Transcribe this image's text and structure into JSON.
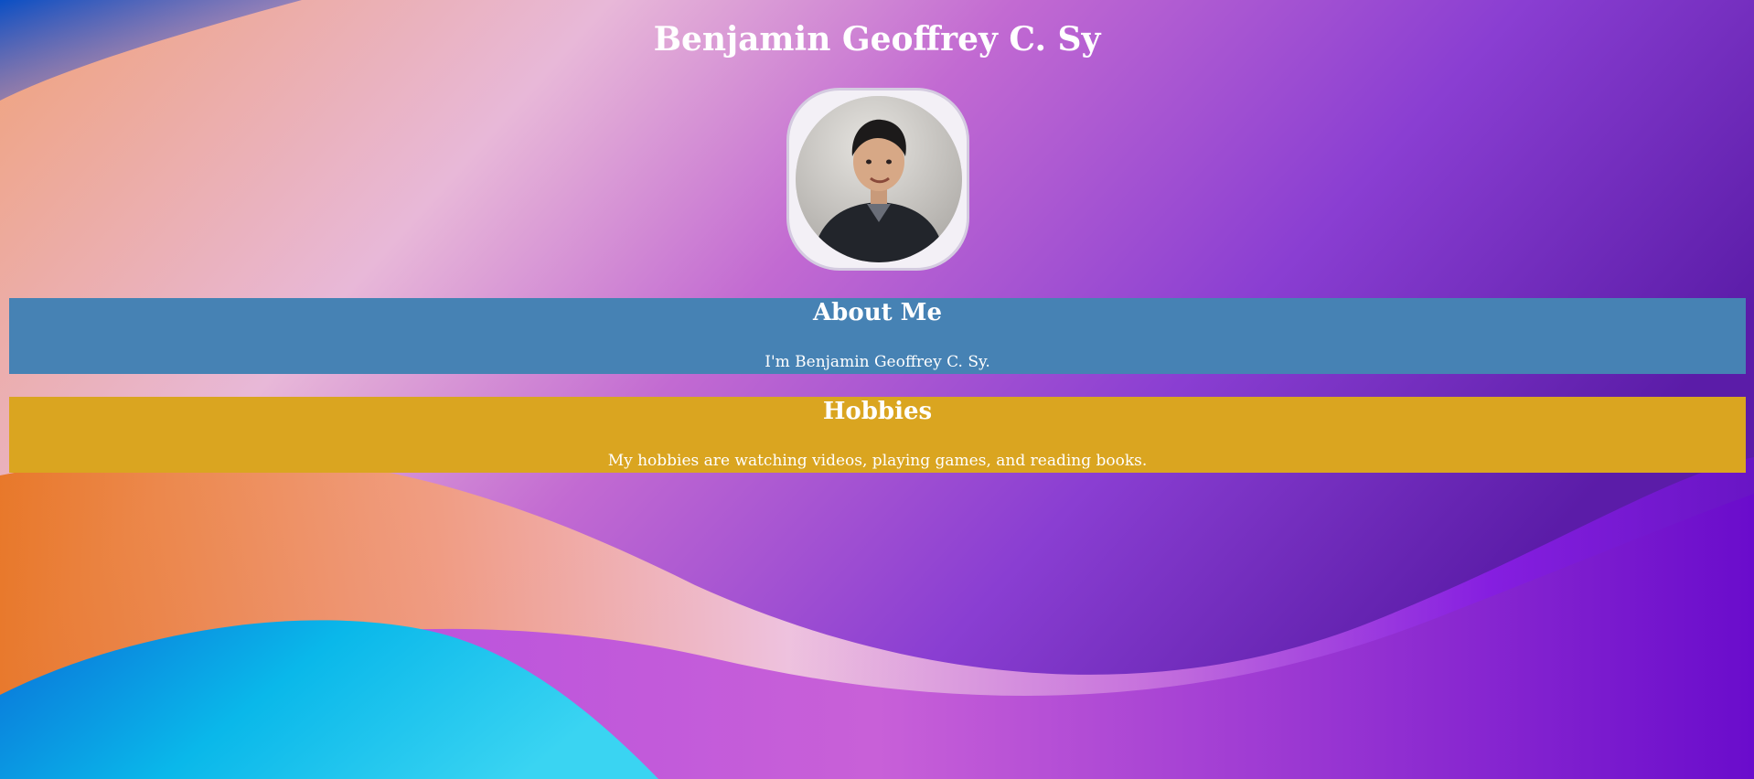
{
  "page": {
    "title": "Benjamin Geoffrey C. Sy"
  },
  "sections": {
    "about": {
      "heading": "About Me",
      "text": "I'm Benjamin Geoffrey C. Sy.",
      "color": "#4682b4"
    },
    "hobbies": {
      "heading": "Hobbies",
      "text": "My hobbies are watching videos, playing games, and reading books.",
      "color": "#daa520"
    }
  },
  "colors": {
    "background_accent": "#7a2fd6",
    "text": "#ffffff"
  }
}
